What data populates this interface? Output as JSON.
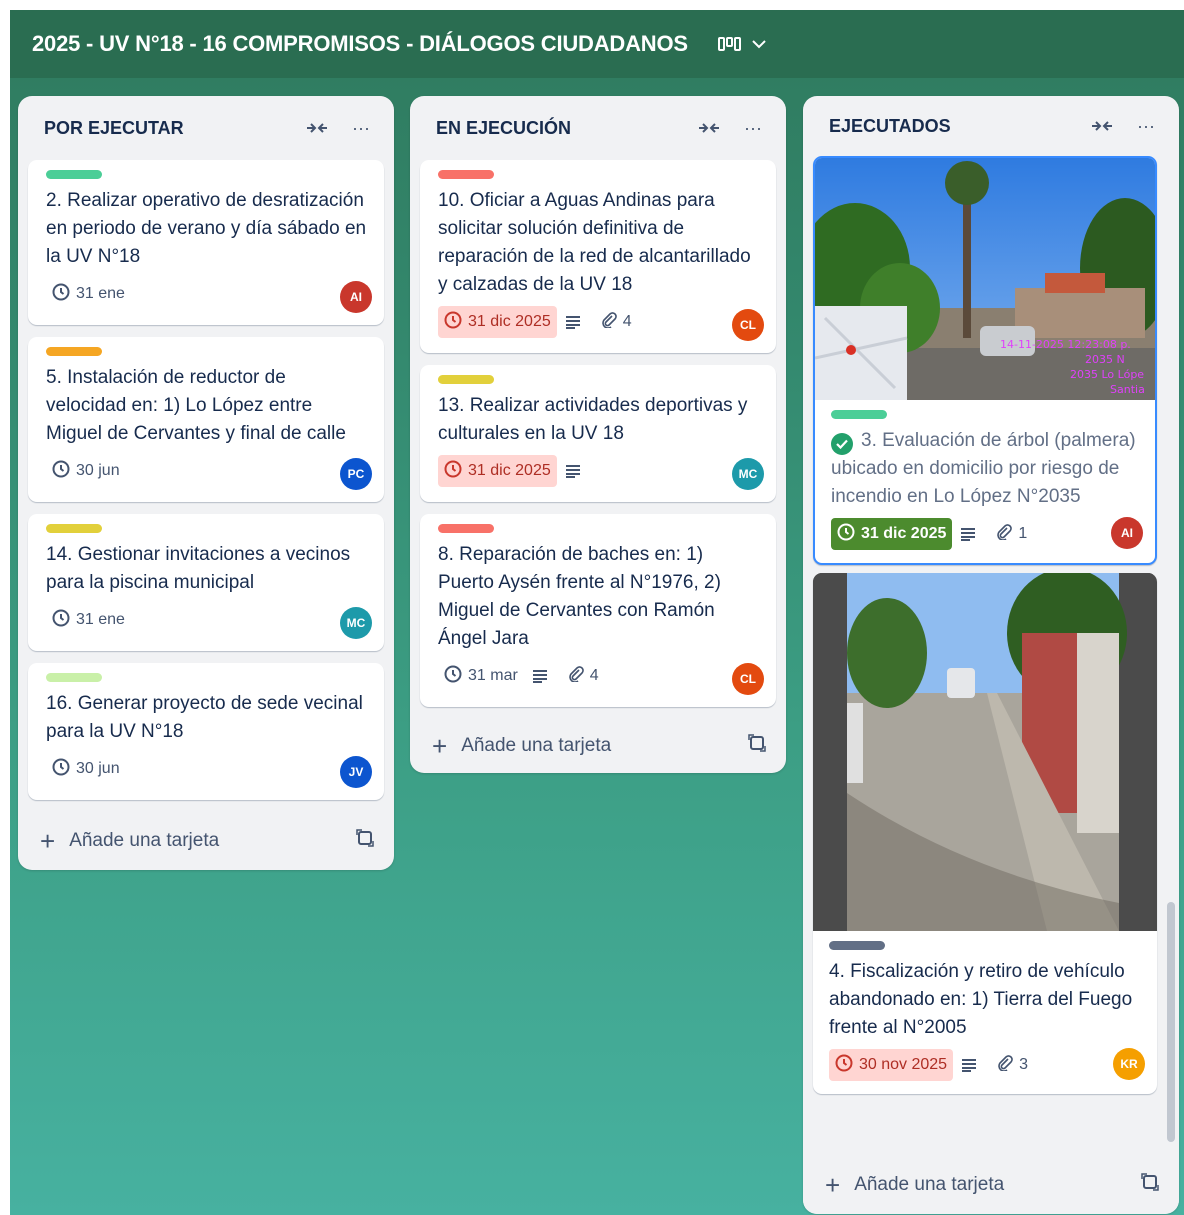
{
  "board": {
    "title": "2025 - UV N°18 - 16 COMPROMISOS - DIÁLOGOS CIUDADANOS",
    "view_icon": "board-view-icon"
  },
  "lists": [
    {
      "title": "POR EJECUTAR",
      "cards": [
        {
          "title": "2. Realizar operativo de desratización en periodo de verano y día sábado en la UV N°18",
          "label_color": "#4bce97",
          "due": "31 ene",
          "avatar": "AI",
          "avatar_color": "#c9372c"
        },
        {
          "title": "5. Instalación de reductor de velocidad en: 1) Lo López entre Miguel de Cervantes y final de calle",
          "label_color": "#f5a623",
          "due": "30 jun",
          "avatar": "PC",
          "avatar_color": "#0c55cf"
        },
        {
          "title": "14. Gestionar invitaciones a vecinos para la piscina municipal",
          "label_color": "#e2d03b",
          "due": "31 ene",
          "avatar": "MC",
          "avatar_color": "#1d9aaa"
        },
        {
          "title": "16. Generar proyecto de sede vecinal para la UV N°18",
          "label_color": "#c9f0a8",
          "due": "30 jun",
          "avatar": "JV",
          "avatar_color": "#0c55cf"
        }
      ],
      "add_label": "Añade una tarjeta"
    },
    {
      "title": "EN EJECUCIÓN",
      "cards": [
        {
          "title": "10. Oficiar a Aguas Andinas para solicitar solución definitiva de reparación de la red de alcantarillado y calzadas de la UV 18",
          "label_color": "#f87168",
          "due": "31 dic 2025",
          "attachments": "4",
          "avatar": "CL",
          "avatar_color": "#e34a0f"
        },
        {
          "title": "13. Realizar actividades deportivas y culturales en la UV 18",
          "label_color": "#e2d03b",
          "due": "31 dic 2025",
          "avatar": "MC",
          "avatar_color": "#1d9aaa"
        },
        {
          "title": "8. Reparación de baches en: 1) Puerto Aysén frente al N°1976, 2) Miguel de Cervantes con Ramón Ángel Jara",
          "label_color": "#f87168",
          "due": "31 mar",
          "attachments": "4",
          "avatar": "CL",
          "avatar_color": "#e34a0f"
        }
      ],
      "add_label": "Añade una tarjeta"
    },
    {
      "title": "EJECUTADOS",
      "cards": [
        {
          "title": "3. Evaluación de árbol (palmera) ubicado en domicilio por riesgo de incendio en Lo López N°2035",
          "label_color": "#4bce97",
          "due": "31 dic 2025",
          "attachments": "1",
          "avatar": "AI",
          "avatar_color": "#c9372c",
          "cover_text": "14-11-2025 12:23:08 p. 2035 N 2035 Lo Lópe Santia"
        },
        {
          "title": "4. Fiscalización y retiro de vehículo abandonado en: 1) Tierra del Fuego frente al N°2005",
          "label_color": "#626f86",
          "due": "30 nov 2025",
          "attachments": "3",
          "avatar": "KR",
          "avatar_color": "#f59f00"
        }
      ],
      "add_label": "Añade una tarjeta"
    }
  ]
}
